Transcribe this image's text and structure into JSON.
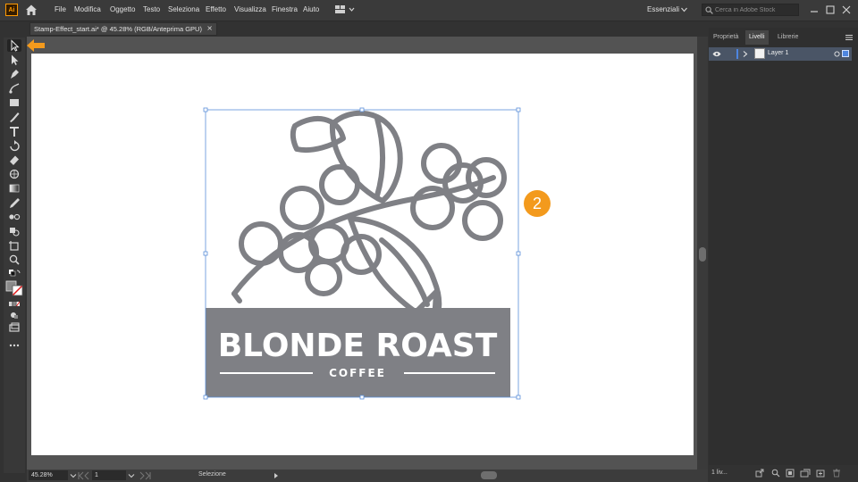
{
  "app": {
    "logo_text": "Ai",
    "menu": [
      "File",
      "Modifica",
      "Oggetto",
      "Testo",
      "Seleziona",
      "Effetto",
      "Visualizza",
      "Finestra",
      "Aiuto"
    ],
    "workspace": "Essenziali",
    "search_placeholder": "Cerca in Adobe Stock"
  },
  "document": {
    "tab_title": "Stamp-Effect_start.ai* @ 45.28% (RGB/Anteprima GPU)",
    "close_glyph": "×"
  },
  "artwork": {
    "title": "BLONDE ROAST",
    "subtitle": "COFFEE",
    "fill_color": "#7f8085",
    "speckle_color": "#b8c2d8"
  },
  "status": {
    "zoom": "45.28%",
    "page": "1",
    "tool": "Selezione"
  },
  "panel": {
    "tabs": [
      "Proprietà",
      "Livelli",
      "Librerie"
    ],
    "active_tab": "Livelli",
    "layers": [
      {
        "name": "Layer 1"
      }
    ],
    "layer_count": "1 liv..."
  },
  "annotations": {
    "step": "2",
    "accent": "#f39a1d"
  }
}
